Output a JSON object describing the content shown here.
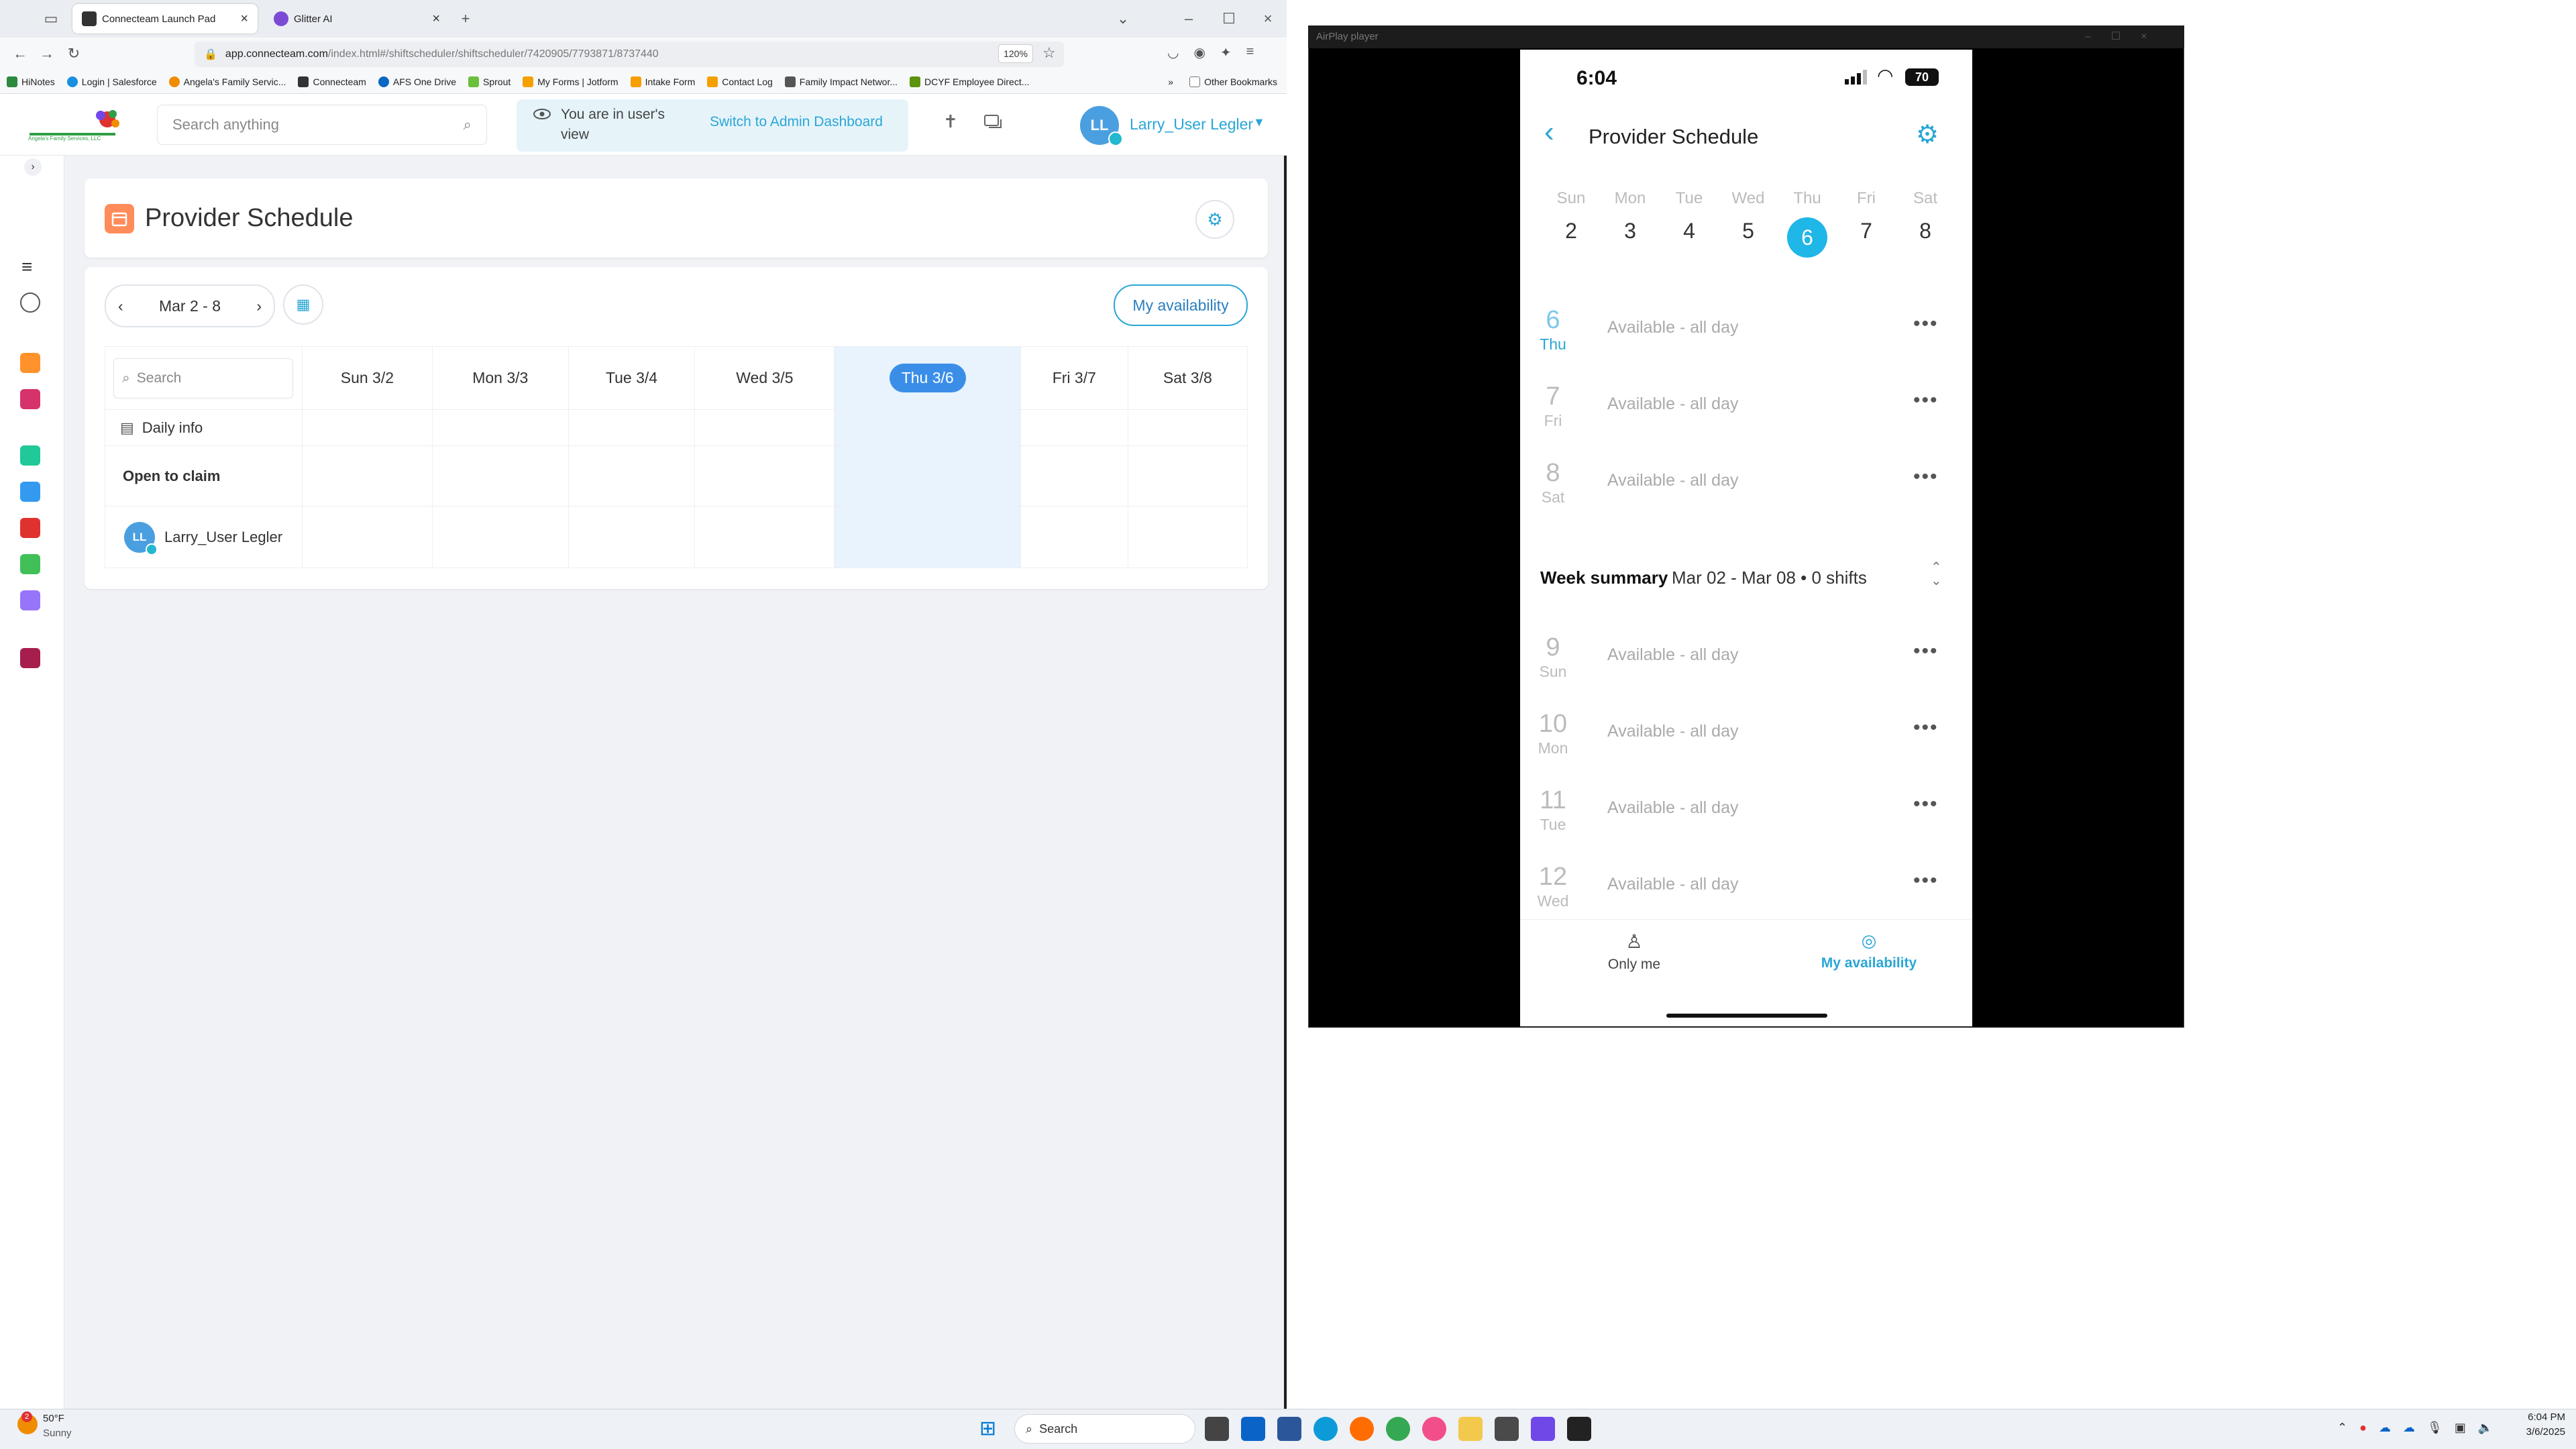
{
  "browser": {
    "tabs": [
      {
        "label": "Connecteam Launch Pad",
        "active": true
      },
      {
        "label": "Glitter AI",
        "active": false
      }
    ],
    "url_domain": "app.connecteam.com",
    "url_path": "/index.html#/shiftscheduler/shiftscheduler/7420905/7793871/8737440",
    "zoom": "120%",
    "bookmarks": [
      "HiNotes",
      "Login | Salesforce",
      "Angela's Family Servic...",
      "Connecteam",
      "AFS One Drive",
      "Sprout",
      "My Forms | Jotform",
      "Intake Form",
      "Contact Log",
      "Family Impact Networ...",
      "DCYF Employee Direct..."
    ],
    "other_bookmarks": "Other Bookmarks"
  },
  "app": {
    "logo_text": "Angela's Family Services, LLC",
    "search_placeholder": "Search anything",
    "user_view_text": "You are in user's view",
    "switch_label": "Switch to Admin Dashboard",
    "user_initials": "LL",
    "user_name": "Larry_User Legler",
    "page_title": "Provider Schedule",
    "date_range": "Mar 2 - 8",
    "my_availability": "My availability",
    "grid_search_placeholder": "Search",
    "days": [
      "Sun 3/2",
      "Mon 3/3",
      "Tue 3/4",
      "Wed 3/5",
      "Thu 3/6",
      "Fri 3/7",
      "Sat 3/8"
    ],
    "daily_info": "Daily info",
    "open_to_claim": "Open to claim",
    "row_user": "Larry_User Legler"
  },
  "airplay": {
    "window_title": "AirPlay player",
    "time": "6:04",
    "battery": "70",
    "title": "Provider Schedule",
    "week_days": [
      "Sun",
      "Mon",
      "Tue",
      "Wed",
      "Thu",
      "Fri",
      "Sat"
    ],
    "week_nums": [
      "2",
      "3",
      "4",
      "5",
      "6",
      "7",
      "8"
    ],
    "selected_index": 4,
    "rows_top": [
      {
        "num": "6",
        "day": "Thu",
        "text": "Available -  all day"
      },
      {
        "num": "7",
        "day": "Fri",
        "text": "Available -  all day"
      },
      {
        "num": "8",
        "day": "Sat",
        "text": "Available -  all day"
      }
    ],
    "summary_label": "Week summary",
    "summary_range": "Mar 02 - Mar 08 • 0 shifts",
    "rows_bottom": [
      {
        "num": "9",
        "day": "Sun",
        "text": "Available -  all day"
      },
      {
        "num": "10",
        "day": "Mon",
        "text": "Available -  all day"
      },
      {
        "num": "11",
        "day": "Tue",
        "text": "Available -  all day"
      },
      {
        "num": "12",
        "day": "Wed",
        "text": "Available -  all day"
      }
    ],
    "tab_only_me": "Only me",
    "tab_my_availability": "My availability"
  },
  "taskbar": {
    "weather_temp": "50°F",
    "weather_desc": "Sunny",
    "weather_badge": "2",
    "search_label": "Search",
    "time": "6:04 PM",
    "date": "3/6/2025"
  },
  "colors": {
    "accent": "#2aa6d6",
    "chip": "#3b8ee8",
    "highlight": "#e8f3fd"
  }
}
